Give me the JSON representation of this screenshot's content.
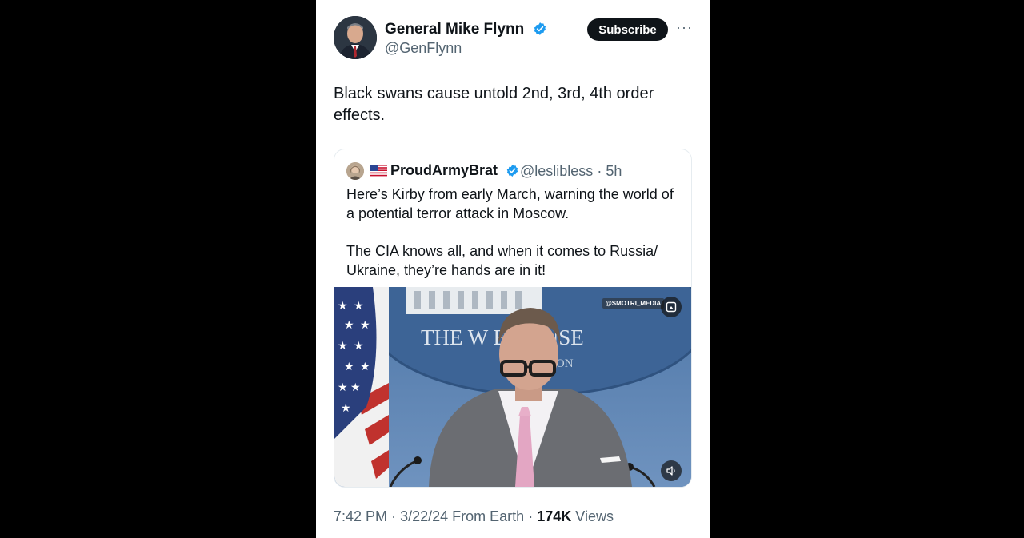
{
  "author": {
    "name": "General Mike Flynn",
    "handle": "@GenFlynn",
    "avatar": "avatar-photo-icon",
    "verified_icon": "verified-badge-icon"
  },
  "actions": {
    "subscribe_label": "Subscribe",
    "more_icon": "more-options-icon",
    "more_glyph": "···"
  },
  "tweet": {
    "text": "Black swans cause untold 2nd, 3rd, 4th order effects."
  },
  "quote": {
    "flag": "🇺🇸",
    "name": "ProudArmyBrat",
    "handle": "@leslibless",
    "separator": "·",
    "age": "5h",
    "paragraph1": "Here’s Kirby from early March, warning the world of a potential terror attack in Moscow.",
    "paragraph2": "The CIA knows all, and when it comes to Russia/ Ukraine, they’re hands are in it!",
    "media": {
      "watermark": "@SMOTRI_MEDIA",
      "backdrop_text": "THE W    E HOUSE",
      "backdrop_text_sub": "TON",
      "volume_icon": "volume-icon",
      "gif_icon": "media-corner-icon"
    }
  },
  "footer": {
    "time": "7:42 PM",
    "sep1": "·",
    "date": "3/22/24",
    "location": "From Earth",
    "sep2": "·",
    "views_count": "174K",
    "views_label": "Views"
  },
  "colors": {
    "text": "#0f1419",
    "secondary": "#536471",
    "verified": "#1d9bf0",
    "button": "#0f1419"
  }
}
